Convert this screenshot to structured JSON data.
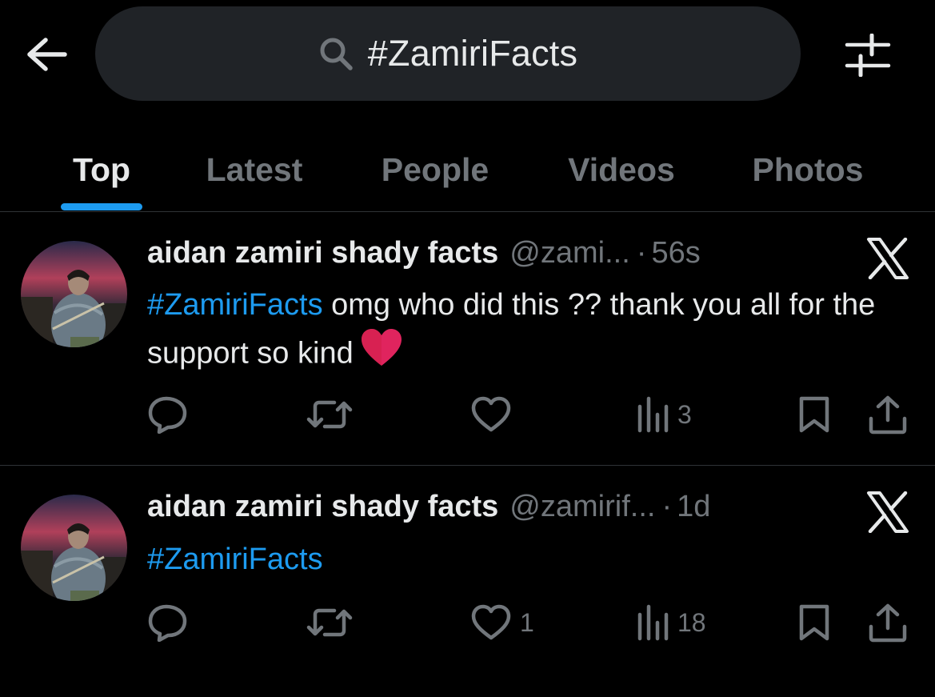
{
  "search": {
    "query": "#ZamiriFacts"
  },
  "tabs": [
    {
      "label": "Top",
      "active": true
    },
    {
      "label": "Latest",
      "active": false
    },
    {
      "label": "People",
      "active": false
    },
    {
      "label": "Videos",
      "active": false
    },
    {
      "label": "Photos",
      "active": false
    }
  ],
  "colors": {
    "accent": "#1d9bf0",
    "background": "#000000",
    "search_bg": "#202327",
    "muted_text": "#71767b",
    "primary_text": "#e7e9ea",
    "heart": "#e0245e"
  },
  "posts": [
    {
      "author": "aidan zamiri shady facts",
      "handle": "@zami...",
      "dot": "·",
      "time": "56s",
      "hashtag": "#ZamiriFacts",
      "text": " omg who did this ?? thank you all for the support so kind",
      "emoji": "red-heart",
      "replies": "",
      "reposts": "",
      "likes": "",
      "views": "3"
    },
    {
      "author": "aidan zamiri shady facts",
      "handle": "@zamirif...",
      "dot": "·",
      "time": "1d",
      "hashtag": "#ZamiriFacts",
      "text": "",
      "replies": "",
      "reposts": "",
      "likes": "1",
      "views": "18"
    }
  ],
  "icons": [
    "back-arrow-icon",
    "search-icon",
    "filter-sliders-icon",
    "x-logo-icon",
    "reply-icon",
    "repost-icon",
    "like-icon",
    "views-icon",
    "bookmark-icon",
    "share-icon"
  ]
}
